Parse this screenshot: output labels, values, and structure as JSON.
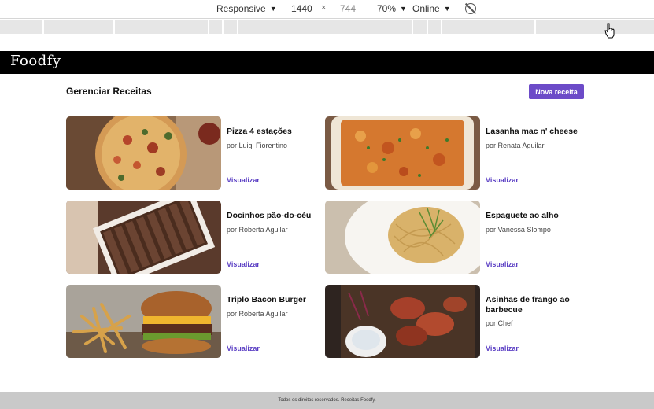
{
  "devtools": {
    "device": "Responsive",
    "width": "1440",
    "height": "744",
    "zoom": "70%",
    "network": "Online",
    "times": "×"
  },
  "site": {
    "logo": "Foodfy",
    "page_title": "Gerenciar Receitas",
    "new_button": "Nova receita",
    "footer": "Todos os direitos reservados. Receitas Foodfy."
  },
  "recipes": [
    {
      "title": "Pizza 4 estações",
      "author": "por Luigi Fiorentino",
      "link": "Visualizar",
      "image": "pizza"
    },
    {
      "title": "Lasanha mac n' cheese",
      "author": "por Renata Aguilar",
      "link": "Visualizar",
      "image": "lasagna"
    },
    {
      "title": "Docinhos pão-do-céu",
      "author": "por Roberta Aguilar",
      "link": "Visualizar",
      "image": "chocolates"
    },
    {
      "title": "Espaguete ao alho",
      "author": "por Vanessa Slompo",
      "link": "Visualizar",
      "image": "spaghetti"
    },
    {
      "title": "Triplo Bacon Burger",
      "author": "por Roberta Aguilar",
      "link": "Visualizar",
      "image": "burger"
    },
    {
      "title": "Asinhas de frango ao barbecue",
      "author": "por Chef",
      "link": "Visualizar",
      "image": "chicken-wings"
    }
  ]
}
